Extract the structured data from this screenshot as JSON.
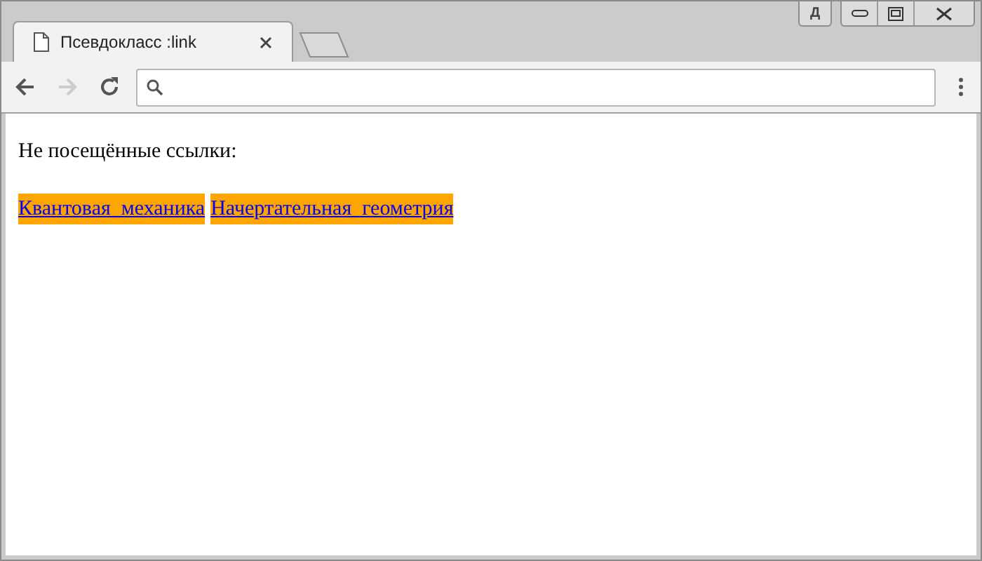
{
  "window": {
    "profile_badge": "Д"
  },
  "tabs": [
    {
      "title": "Псевдокласс :link",
      "selected": true
    }
  ],
  "page": {
    "heading": "Не посещённые ссылки:",
    "links": [
      {
        "text": "Квантовая_механика",
        "visited": false
      },
      {
        "text": "Начертательная_геометрия",
        "visited": false
      }
    ]
  }
}
